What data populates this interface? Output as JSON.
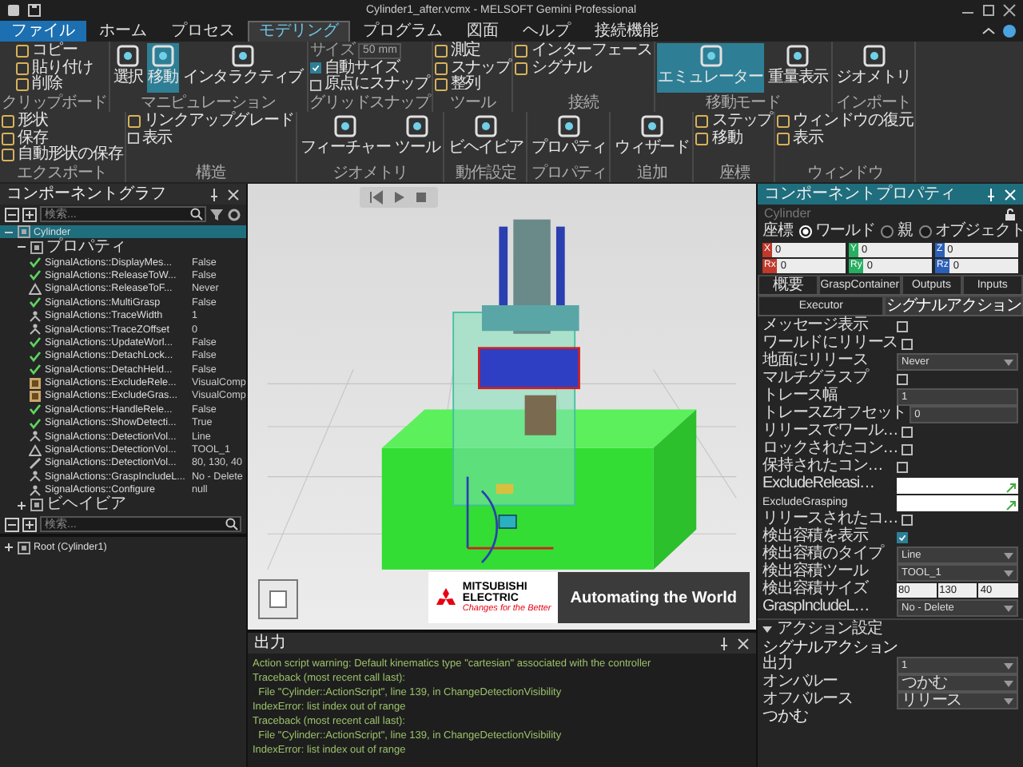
{
  "window": {
    "title": "Cylinder1_after.vcmx - MELSOFT Gemini Professional"
  },
  "tabs": [
    {
      "label": "ファイル",
      "kind": "file",
      "selected": false
    },
    {
      "label": "ホーム",
      "kind": "tab",
      "selected": false
    },
    {
      "label": "プロセス",
      "kind": "tab",
      "selected": false
    },
    {
      "label": "モデリング",
      "kind": "tab",
      "selected": true
    },
    {
      "label": "プログラム",
      "kind": "tab",
      "selected": false
    },
    {
      "label": "図面",
      "kind": "tab",
      "selected": false
    },
    {
      "label": "ヘルプ",
      "kind": "tab",
      "selected": false
    },
    {
      "label": "接続機能",
      "kind": "tab",
      "selected": false
    }
  ],
  "ribbon": [
    {
      "label": "クリップボード",
      "items": [
        {
          "kind": "small",
          "label": "コピー"
        },
        {
          "kind": "small",
          "label": "貼り付け"
        },
        {
          "kind": "small",
          "label": "削除"
        }
      ]
    },
    {
      "label": "マニピュレーション",
      "items": [
        {
          "kind": "large",
          "label": "選択",
          "selected": false
        },
        {
          "kind": "large",
          "label": "移動",
          "selected": true
        },
        {
          "kind": "large",
          "label": "インタラクティブ",
          "selected": false
        }
      ]
    },
    {
      "label": "グリッドスナップ",
      "items": [
        {
          "kind": "field",
          "label": "サイズ",
          "value": "50 mm",
          "disabled": true
        },
        {
          "kind": "check",
          "label": "自動サイズ",
          "checked": true
        },
        {
          "kind": "check",
          "label": "原点にスナップ",
          "checked": false
        }
      ]
    },
    {
      "label": "ツール",
      "items": [
        {
          "kind": "small",
          "label": "測定"
        },
        {
          "kind": "small",
          "label": "スナップ"
        },
        {
          "kind": "small",
          "label": "整列"
        }
      ]
    },
    {
      "label": "接続",
      "items": [
        {
          "kind": "small",
          "label": "インターフェース"
        },
        {
          "kind": "small",
          "label": "シグナル"
        }
      ]
    },
    {
      "label": "移動モード",
      "items": [
        {
          "kind": "large",
          "label": "エミュレーター",
          "selected": true
        },
        {
          "kind": "large",
          "label": "重量表示",
          "selected": false
        }
      ]
    },
    {
      "label": "インポート",
      "items": [
        {
          "kind": "large",
          "label": "ジオメトリ",
          "selected": false
        }
      ]
    },
    {
      "label": "エクスポート",
      "items": [
        {
          "kind": "small",
          "label": "形状"
        },
        {
          "kind": "small",
          "label": "保存"
        },
        {
          "kind": "small",
          "label": "自動形状の保存"
        }
      ]
    },
    {
      "label": "構造",
      "items": [
        {
          "kind": "small",
          "label": "リンクアップグレード"
        },
        {
          "kind": "check",
          "label": "表示",
          "checked": false
        }
      ]
    },
    {
      "label": "ジオメトリ",
      "items": [
        {
          "kind": "large",
          "label": "フィーチャー",
          "selected": false
        },
        {
          "kind": "large",
          "label": "ツール",
          "selected": false
        }
      ]
    },
    {
      "label": "動作設定",
      "items": [
        {
          "kind": "large",
          "label": "ビヘイビア",
          "selected": false
        }
      ]
    },
    {
      "label": "プロパティ",
      "items": [
        {
          "kind": "large",
          "label": "プロパティ",
          "selected": false
        }
      ]
    },
    {
      "label": "追加",
      "items": [
        {
          "kind": "large",
          "label": "ウィザード",
          "selected": false
        }
      ]
    },
    {
      "label": "座標",
      "items": [
        {
          "kind": "small",
          "label": "ステップ"
        },
        {
          "kind": "small",
          "label": "移動"
        }
      ]
    },
    {
      "label": "ウィンドウ",
      "items": [
        {
          "kind": "small",
          "label": "ウィンドウの復元"
        },
        {
          "kind": "small",
          "label": "表示"
        }
      ]
    }
  ],
  "component_graph": {
    "title": "コンポーネントグラフ",
    "search": {
      "placeholder": "検索..."
    },
    "tree": [
      {
        "label": "Cylinder",
        "selected": true,
        "expanded": true,
        "children": [
          {
            "label": "プロパティ",
            "selected": false,
            "expanded": true,
            "children": [
              {
                "label": "SignalActions::DisplayMes...",
                "value": "False",
                "kind": "check"
              },
              {
                "label": "SignalActions::ReleaseToW...",
                "value": "False",
                "kind": "check"
              },
              {
                "label": "SignalActions::ReleaseToF...",
                "value": "Never",
                "kind": "triangle"
              },
              {
                "label": "SignalActions::MultiGrasp",
                "value": "False",
                "kind": "check"
              },
              {
                "label": "SignalActions::TraceWidth",
                "value": "1",
                "kind": "figure"
              },
              {
                "label": "SignalActions::TraceZOffset",
                "value": "0",
                "kind": "figure"
              },
              {
                "label": "SignalActions::UpdateWorl...",
                "value": "False",
                "kind": "check"
              },
              {
                "label": "SignalActions::DetachLock...",
                "value": "False",
                "kind": "check"
              },
              {
                "label": "SignalActions::DetachHeld...",
                "value": "False",
                "kind": "check"
              },
              {
                "label": "SignalActions::ExcludeRele...",
                "value": "VisualComp",
                "kind": "image"
              },
              {
                "label": "SignalActions::ExcludeGras...",
                "value": "VisualComp",
                "kind": "image"
              },
              {
                "label": "SignalActions::HandleRele...",
                "value": "False",
                "kind": "check"
              },
              {
                "label": "SignalActions::ShowDetecti...",
                "value": "True",
                "kind": "check"
              },
              {
                "label": "SignalActions::DetectionVol...",
                "value": "Line",
                "kind": "figure"
              },
              {
                "label": "SignalActions::DetectionVol...",
                "value": "TOOL_1",
                "kind": "triangle"
              },
              {
                "label": "SignalActions::DetectionVol...",
                "value": "80, 130, 40",
                "kind": "pencil"
              },
              {
                "label": "SignalActions::GraspIncludeL...",
                "value": "No - Delete",
                "kind": "figure"
              },
              {
                "label": "SignalActions::Configure",
                "value": "null",
                "kind": "figure"
              }
            ]
          },
          {
            "label": "ビヘイビア",
            "selected": false,
            "expanded": false
          }
        ]
      }
    ],
    "bottom_search": {
      "placeholder": "検索..."
    },
    "root_tree": [
      {
        "label": "Root (Cylinder1)",
        "selected": false,
        "expanded": false
      }
    ]
  },
  "output": {
    "title": "出力",
    "lines": [
      "Action script warning: Default kinematics type \"cartesian\" associated with the controller",
      "Traceback (most recent call last):",
      "  File \"Cylinder::ActionScript\", line 139, in ChangeDetectionVisibility",
      "IndexError: list index out of range",
      "Traceback (most recent call last):",
      "  File \"Cylinder::ActionScript\", line 139, in ChangeDetectionVisibility",
      "IndexError: list index out of range"
    ]
  },
  "properties": {
    "title": "コンポーネントプロパティ",
    "name": "Cylinder",
    "coordinate": {
      "label": "座標",
      "options": [
        {
          "label": "ワールド",
          "selected": true
        },
        {
          "label": "親",
          "selected": false
        },
        {
          "label": "オブジェクト",
          "selected": false
        }
      ]
    },
    "position": [
      {
        "axis": "X",
        "value": "0",
        "color": "#c0392b"
      },
      {
        "axis": "Y",
        "value": "0",
        "color": "#27ae60"
      },
      {
        "axis": "Z",
        "value": "0",
        "color": "#2c5fb8"
      },
      {
        "axis": "Rx",
        "value": "0",
        "color": "#c0392b"
      },
      {
        "axis": "Ry",
        "value": "0",
        "color": "#27ae60"
      },
      {
        "axis": "Rz",
        "value": "0",
        "color": "#2c5fb8"
      }
    ],
    "tabs": [
      {
        "label": "概要",
        "selected": false
      },
      {
        "label": "GraspContainer",
        "selected": false
      },
      {
        "label": "Outputs",
        "selected": false
      },
      {
        "label": "Inputs",
        "selected": false
      }
    ],
    "subtabs": [
      {
        "label": "Executor",
        "selected": false
      },
      {
        "label": "シグナルアクション",
        "selected": true
      }
    ],
    "rows": [
      {
        "kind": "check",
        "label": "メッセージ表示",
        "checked": false
      },
      {
        "kind": "check",
        "label": "ワールドにリリース",
        "checked": false
      },
      {
        "kind": "select",
        "label": "地面にリリース",
        "value": "Never"
      },
      {
        "kind": "check",
        "label": "マルチグラスプ",
        "checked": false
      },
      {
        "kind": "field",
        "label": "トレース幅",
        "value": "1"
      },
      {
        "kind": "field",
        "label": "トレースZオフセット",
        "value": "0"
      },
      {
        "kind": "check",
        "label": "リリースでワール…",
        "checked": false
      },
      {
        "kind": "check",
        "label": "ロックされたコン…",
        "checked": false
      },
      {
        "kind": "check",
        "label": "保持されたコン…",
        "checked": false
      },
      {
        "kind": "wide",
        "label": "ExcludeReleasi…",
        "value": ""
      },
      {
        "kind": "wide",
        "label": "ExcludeGrasping",
        "value": ""
      },
      {
        "kind": "check",
        "label": "リリースされたコ…",
        "checked": false
      },
      {
        "kind": "check",
        "label": "検出容積を表示",
        "checked": true
      },
      {
        "kind": "select",
        "label": "検出容積のタイプ",
        "value": "Line"
      },
      {
        "kind": "select",
        "label": "検出容積ツール",
        "value": "TOOL_1"
      },
      {
        "kind": "xyz",
        "label": "検出容積サイズ",
        "values": [
          "80",
          "130",
          "40"
        ]
      },
      {
        "kind": "select",
        "label": "GraspIncludeL…",
        "value": "No - Delete"
      }
    ],
    "section": {
      "label": "アクション設定",
      "expanded": true,
      "heading": "シグナルアクション",
      "rows": [
        {
          "label": "出力",
          "value": "1"
        },
        {
          "label": "オンバルー",
          "value": "つかむ"
        },
        {
          "label": "オフバルース",
          "value": "リリース"
        }
      ],
      "subheading": "つかむ"
    }
  },
  "banner": {
    "brand": [
      "MITSUBISHI",
      "ELECTRIC"
    ],
    "tagline": "Changes for the Better",
    "slogan": "Automating the World"
  }
}
